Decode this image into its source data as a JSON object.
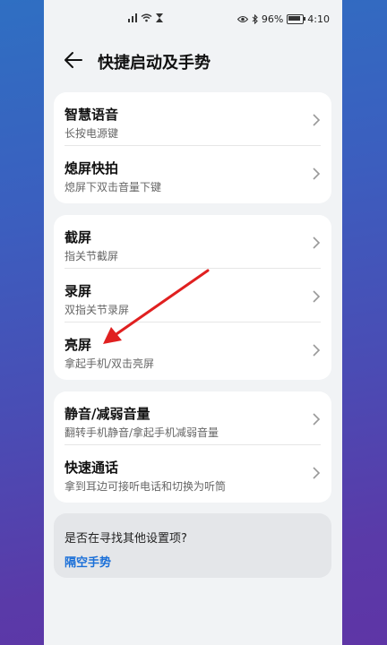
{
  "status_bar": {
    "battery_percent": "96%",
    "time": "4:10"
  },
  "header": {
    "title": "快捷启动及手势"
  },
  "groups": [
    {
      "items": [
        {
          "label": "智慧语音",
          "sub": "长按电源键"
        },
        {
          "label": "熄屏快拍",
          "sub": "熄屏下双击音量下键"
        }
      ]
    },
    {
      "items": [
        {
          "label": "截屏",
          "sub": "指关节截屏"
        },
        {
          "label": "录屏",
          "sub": "双指关节录屏"
        },
        {
          "label": "亮屏",
          "sub": "拿起手机/双击亮屏"
        }
      ]
    },
    {
      "items": [
        {
          "label": "静音/减弱音量",
          "sub": "翻转手机静音/拿起手机减弱音量"
        },
        {
          "label": "快速通话",
          "sub": "拿到耳边可接听电话和切换为听筒"
        }
      ]
    }
  ],
  "suggestion": {
    "question": "是否在寻找其他设置项?",
    "link": "隔空手势"
  },
  "annotation_color": "#e02020"
}
